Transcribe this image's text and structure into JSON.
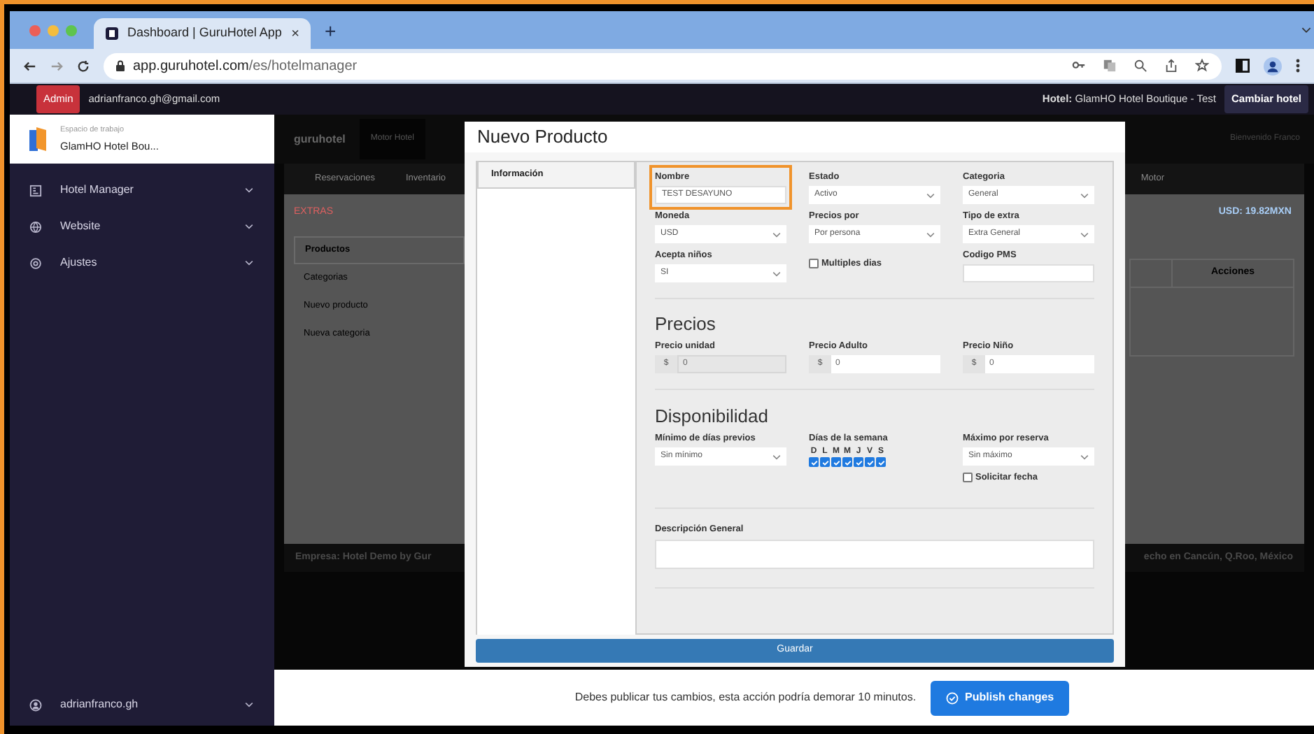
{
  "browser": {
    "tab": {
      "title": "Dashboard | GuruHotel App",
      "close": "×"
    },
    "new_tab": "+",
    "url_host": "app.guruhotel.com",
    "url_path": "/es/hotelmanager"
  },
  "top_bar": {
    "role_badge": "Admin",
    "email": "adrianfranco.gh@gmail.com",
    "hotel": "**Hotel:** GlamHO Hotel Boutique - Test",
    "switch_button": "Cambiar hotel"
  },
  "sidebar": {
    "workspace_label": "Espacio de trabajo",
    "workspace_name": "GlamHO Hotel Bou...",
    "items": [
      {
        "label": "Hotel Manager"
      },
      {
        "label": "Website"
      },
      {
        "label": "Ajustes"
      }
    ],
    "user": "adrianfranco.gh"
  },
  "background": {
    "logo": "guruhotel",
    "nav": [
      "Motor Hotel"
    ],
    "greeting": "Bienvenido Franco",
    "subnav": [
      "Reservaciones",
      "Inventario"
    ],
    "subnav_right": "Motor",
    "section": "EXTRAS",
    "rate": "USD: 19.82MXN",
    "menu": [
      {
        "label": "Productos",
        "selected": true
      },
      {
        "label": "Categorias",
        "selected": false
      },
      {
        "label": "Nuevo producto",
        "selected": false
      },
      {
        "label": "Nueva categoria",
        "selected": false
      }
    ],
    "table_header": "Acciones",
    "footer_left": "Empresa: Hotel Demo by Gur",
    "footer_right": "echo en Cancún, Q.Roo, México"
  },
  "modal": {
    "title": "Nuevo Producto",
    "tabs": [
      {
        "label": "Información",
        "selected": true
      }
    ],
    "general": [
      {
        "kind": "text",
        "label": "Nombre",
        "value": "TEST DESAYUNO",
        "highlighted": true
      },
      {
        "kind": "select",
        "label": "Estado",
        "value": "Activo",
        "highlighted": false
      },
      {
        "kind": "select",
        "label": "Categoria",
        "value": "General",
        "highlighted": false
      },
      {
        "kind": "select",
        "label": "Moneda",
        "value": "USD",
        "highlighted": false
      },
      {
        "kind": "select",
        "label": "Precios por",
        "value": "Por persona",
        "highlighted": false
      },
      {
        "kind": "select",
        "label": "Tipo de extra",
        "value": "Extra General",
        "highlighted": false
      },
      {
        "kind": "select",
        "label": "Acepta niños",
        "value": "SI",
        "highlighted": false
      },
      {
        "kind": "checkbox",
        "label": "Multiples dias",
        "checked": false,
        "highlighted": false
      },
      {
        "kind": "text",
        "label": "Codigo PMS",
        "highlighted": false
      }
    ],
    "prices": {
      "heading": "Precios",
      "fields": [
        {
          "label": "Precio unidad",
          "prefix": "$",
          "value": "0",
          "disabled": true
        },
        {
          "label": "Precio Adulto",
          "prefix": "$",
          "value": "0",
          "disabled": false
        },
        {
          "label": "Precio Niño",
          "prefix": "$",
          "value": "0",
          "disabled": false
        }
      ]
    },
    "availability": {
      "heading": "Disponibilidad",
      "min_days": {
        "label": "Mínimo de días previos",
        "value": "Sin mínimo"
      },
      "weekdays": {
        "label": "Días de la semana",
        "days": [
          {
            "letter": "D",
            "checked": true
          },
          {
            "letter": "L",
            "checked": true
          },
          {
            "letter": "M",
            "checked": true
          },
          {
            "letter": "M",
            "checked": true
          },
          {
            "letter": "J",
            "checked": true
          },
          {
            "letter": "V",
            "checked": true
          },
          {
            "letter": "S",
            "checked": true
          }
        ]
      },
      "max": {
        "label": "Máximo por reserva",
        "value": "Sin máximo"
      },
      "request_date": {
        "label": "Solicitar fecha",
        "checked": false
      }
    },
    "description": {
      "label": "Descripción General"
    },
    "save_button": "Guardar"
  },
  "publish_bar": {
    "message": "Debes publicar tus cambios, esta acción podría demorar 10 minutos.",
    "button": "Publish changes"
  }
}
